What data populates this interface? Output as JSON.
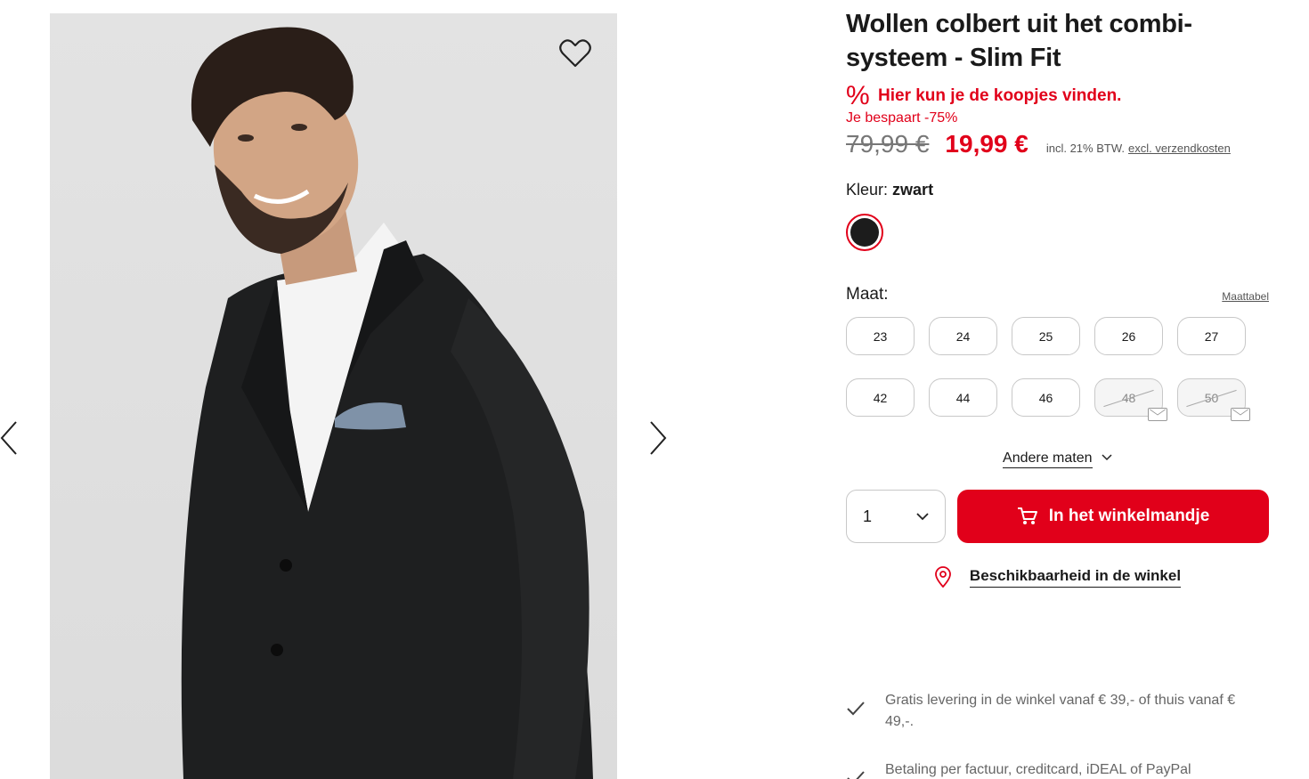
{
  "product": {
    "title": "Wollen colbert uit het combi-systeem - Slim Fit",
    "promo_icon": "%",
    "promo_text": "Hier kun je de koopjes vinden.",
    "saving": "Je bespaart -75%",
    "old_price": "79,99 €",
    "new_price": "19,99 €",
    "vat": "incl. 21% BTW.",
    "shipping_link": "excl. verzendkosten"
  },
  "color": {
    "label": "Kleur:",
    "value": "zwart",
    "swatch_hex": "#1c1c1c"
  },
  "sizes": {
    "label": "Maat:",
    "size_table_link": "Maattabel",
    "row1": [
      "23",
      "24",
      "25",
      "26",
      "27"
    ],
    "row2": [
      "42",
      "44",
      "46"
    ],
    "unavailable": [
      "48",
      "50"
    ],
    "other_sizes": "Andere maten"
  },
  "cart": {
    "quantity": "1",
    "add_button": "In het winkelmandje"
  },
  "store": {
    "availability": "Beschikbaarheid in de winkel"
  },
  "benefits": [
    "Gratis levering in de winkel vanaf € 39,- of thuis vanaf € 49,-.",
    "Betaling per factuur, creditcard, iDEAL of PayPal"
  ],
  "colors": {
    "accent": "#e1001a"
  },
  "icons": {
    "prev": "chevron-left-icon",
    "next": "chevron-right-icon",
    "wishlist": "heart-icon",
    "cart": "cart-icon",
    "location": "map-pin-icon",
    "check": "check-icon"
  }
}
